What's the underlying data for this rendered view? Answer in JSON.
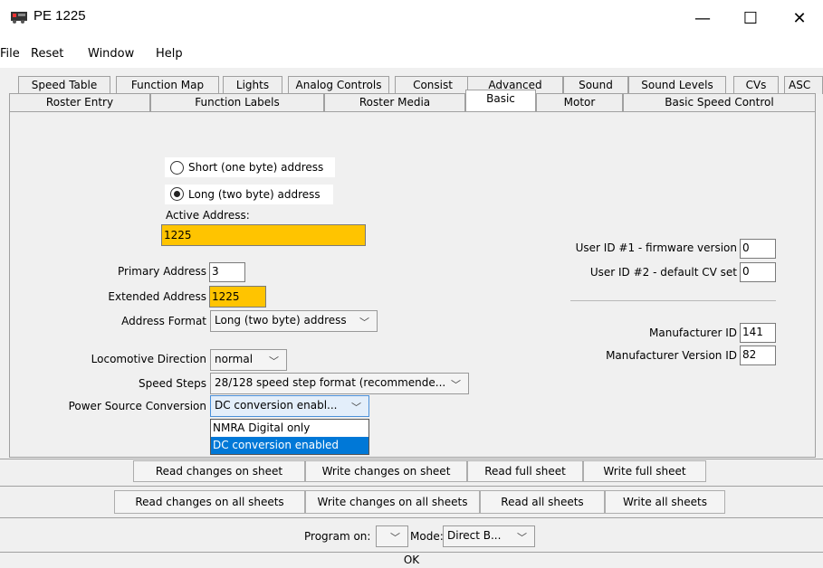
{
  "window": {
    "title": "PE 1225",
    "minimize": "—",
    "maximize": "☐",
    "close": "✕"
  },
  "menu": [
    "File",
    "Reset",
    "Window",
    "Help"
  ],
  "tabs_row1": [
    "Speed Table",
    "Function Map",
    "Lights",
    "Analog Controls",
    "Consist",
    "Advanced",
    "Sound",
    "Sound Levels",
    "CVs",
    "ASC"
  ],
  "tabs_row2": [
    "Roster Entry",
    "Function Labels",
    "Roster Media",
    "Basic",
    "Motor",
    "Basic Speed Control"
  ],
  "selected_tab": "Basic",
  "address": {
    "short_label": "Short (one byte) address",
    "long_label": "Long (two byte) address",
    "selected": "long",
    "active_label": "Active Address:",
    "active_value": "1225",
    "primary_label": "Primary Address",
    "primary_value": "3",
    "extended_label": "Extended Address",
    "extended_value": "1225",
    "format_label": "Address Format",
    "format_value": "Long (two byte) address"
  },
  "locomotive": {
    "direction_label": "Locomotive Direction",
    "direction_value": "normal",
    "speed_steps_label": "Speed Steps",
    "speed_steps_value": "28/128 speed step format (recommende...",
    "power_label": "Power Source Conversion",
    "power_value": "DC conversion enabl...",
    "power_options": [
      "NMRA Digital only",
      "DC conversion enabled"
    ],
    "power_selected_index": 1
  },
  "user_ids": {
    "id1_label": "User ID #1 - firmware version",
    "id1_value": "0",
    "id2_label": "User ID #2 - default CV set",
    "id2_value": "0"
  },
  "manufacturer": {
    "id_label": "Manufacturer ID",
    "id_value": "141",
    "version_label": "Manufacturer Version ID",
    "version_value": "82"
  },
  "buttons_row1": [
    "Read changes on sheet",
    "Write changes on sheet",
    "Read full sheet",
    "Write full sheet"
  ],
  "buttons_row2": [
    "Read changes on all sheets",
    "Write changes on all sheets",
    "Read all sheets",
    "Write all sheets"
  ],
  "program": {
    "program_on_label": "Program on:",
    "program_on_value": "",
    "mode_label": "Mode:",
    "mode_value": "Direct B..."
  },
  "ok_label": "OK",
  "icons": {
    "app": "train-icon",
    "chevron": "chevron-down-icon"
  },
  "colors": {
    "highlight": "#ffc400",
    "selection": "#0078d7"
  }
}
